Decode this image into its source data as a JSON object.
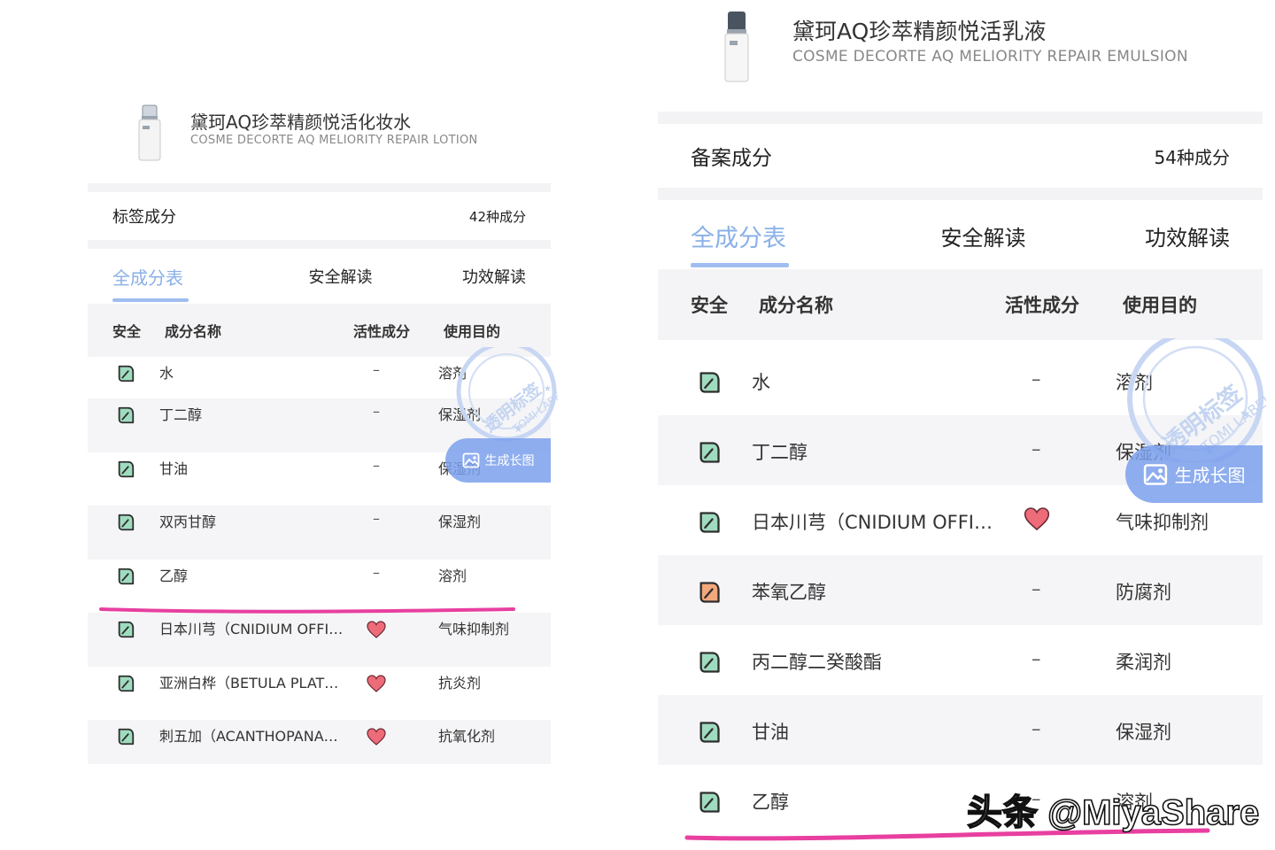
{
  "left": {
    "product_name": "黛珂AQ珍萃精颜悦活化妆水",
    "product_en": "COSME DECORTE AQ MELIORITY REPAIR LOTION",
    "summary_label": "标签成分",
    "summary_count": "42种成分",
    "tabs": [
      "全成分表",
      "安全解读",
      "功效解读"
    ],
    "headers": {
      "safety": "安全",
      "name": "成分名称",
      "active": "活性成分",
      "purpose": "使用目的"
    },
    "rows": [
      {
        "leaf": "green",
        "name": "水",
        "active": "–",
        "purpose": "溶剂"
      },
      {
        "leaf": "green",
        "name": "丁二醇",
        "active": "–",
        "purpose": "保湿剂"
      },
      {
        "leaf": "green",
        "name": "甘油",
        "active": "–",
        "purpose": "保湿剂"
      },
      {
        "leaf": "green",
        "name": "双丙甘醇",
        "active": "–",
        "purpose": "保湿剂"
      },
      {
        "leaf": "green",
        "name": "乙醇",
        "active": "–",
        "purpose": "溶剂"
      },
      {
        "leaf": "green",
        "name": "日本川芎（CNIDIUM OFFI…",
        "active": "heart",
        "purpose": "气味抑制剂"
      },
      {
        "leaf": "green",
        "name": "亚洲白桦（BETULA PLAT…",
        "active": "heart",
        "purpose": "抗炎剂"
      },
      {
        "leaf": "green",
        "name": "刺五加（ACANTHOPANA…",
        "active": "heart",
        "purpose": "抗氧化剂"
      }
    ],
    "gen_button": "生成长图",
    "stamp_text": "透明标签",
    "stamp_en": "TOMI LABEL"
  },
  "right": {
    "product_name": "黛珂AQ珍萃精颜悦活乳液",
    "product_en": "COSME DECORTE AQ MELIORITY REPAIR EMULSION",
    "summary_label": "备案成分",
    "summary_count": "54种成分",
    "tabs": [
      "全成分表",
      "安全解读",
      "功效解读"
    ],
    "headers": {
      "safety": "安全",
      "name": "成分名称",
      "active": "活性成分",
      "purpose": "使用目的"
    },
    "rows": [
      {
        "leaf": "green",
        "name": "水",
        "active": "–",
        "purpose": "溶剂"
      },
      {
        "leaf": "green",
        "name": "丁二醇",
        "active": "–",
        "purpose": "保湿剂"
      },
      {
        "leaf": "green",
        "name": "日本川芎（CNIDIUM OFFI…",
        "active": "heart",
        "purpose": "气味抑制剂"
      },
      {
        "leaf": "orange",
        "name": "苯氧乙醇",
        "active": "–",
        "purpose": "防腐剂"
      },
      {
        "leaf": "green",
        "name": "丙二醇二癸酸酯",
        "active": "–",
        "purpose": "柔润剂"
      },
      {
        "leaf": "green",
        "name": "甘油",
        "active": "–",
        "purpose": "保湿剂"
      },
      {
        "leaf": "green",
        "name": "乙醇",
        "active": "–",
        "purpose": "溶剂"
      }
    ],
    "gen_button": "生成长图",
    "stamp_text": "透明标签",
    "stamp_en": "TOMI LABEL"
  },
  "watermark": "头条 @MiyaShare",
  "colors": {
    "tab_active": "#8ab0e8",
    "leaf_green": "#9fdcbf",
    "leaf_orange": "#f2a87c",
    "heart": "#ee6b7a",
    "highlight_line": "#e83fa0",
    "gen_button": "#7ba0ec"
  }
}
